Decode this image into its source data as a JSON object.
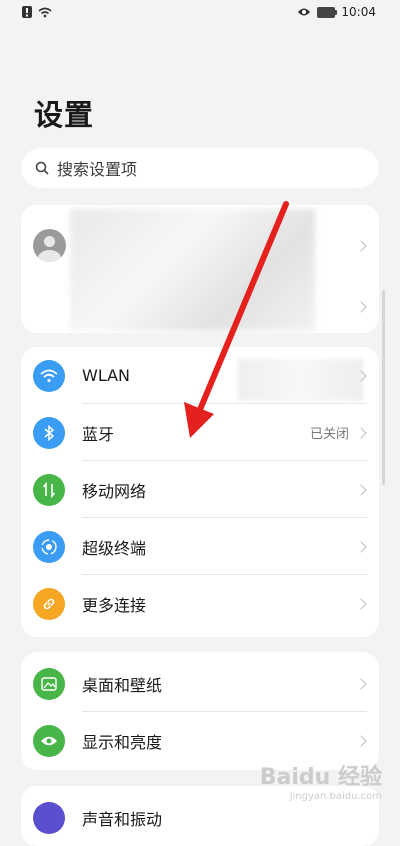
{
  "status_bar": {
    "time": "10:04"
  },
  "title": "设置",
  "search": {
    "placeholder": "搜索设置项"
  },
  "network_items": [
    {
      "label": "WLAN",
      "value": "",
      "icon": "wifi-icon",
      "color": "#3a9cf2"
    },
    {
      "label": "蓝牙",
      "value": "已关闭",
      "icon": "bluetooth-icon",
      "color": "#3a9cf2"
    },
    {
      "label": "移动网络",
      "value": "",
      "icon": "mobile-data-icon",
      "color": "#48b548"
    },
    {
      "label": "超级终端",
      "value": "",
      "icon": "super-device-icon",
      "color": "#3a9cf2"
    },
    {
      "label": "更多连接",
      "value": "",
      "icon": "link-icon",
      "color": "#f5a623"
    }
  ],
  "display_items": [
    {
      "label": "桌面和壁纸",
      "icon": "wallpaper-icon",
      "color": "#48b548"
    },
    {
      "label": "显示和亮度",
      "icon": "eye-icon",
      "color": "#48b548"
    }
  ],
  "sound_item": {
    "label": "声音和振动",
    "icon": "sound-icon",
    "color": "#5a4fcf"
  },
  "watermark": {
    "brand": "Baidu 经验",
    "url": "jingyan.baidu.com"
  },
  "annotation_color": "#e5211d"
}
